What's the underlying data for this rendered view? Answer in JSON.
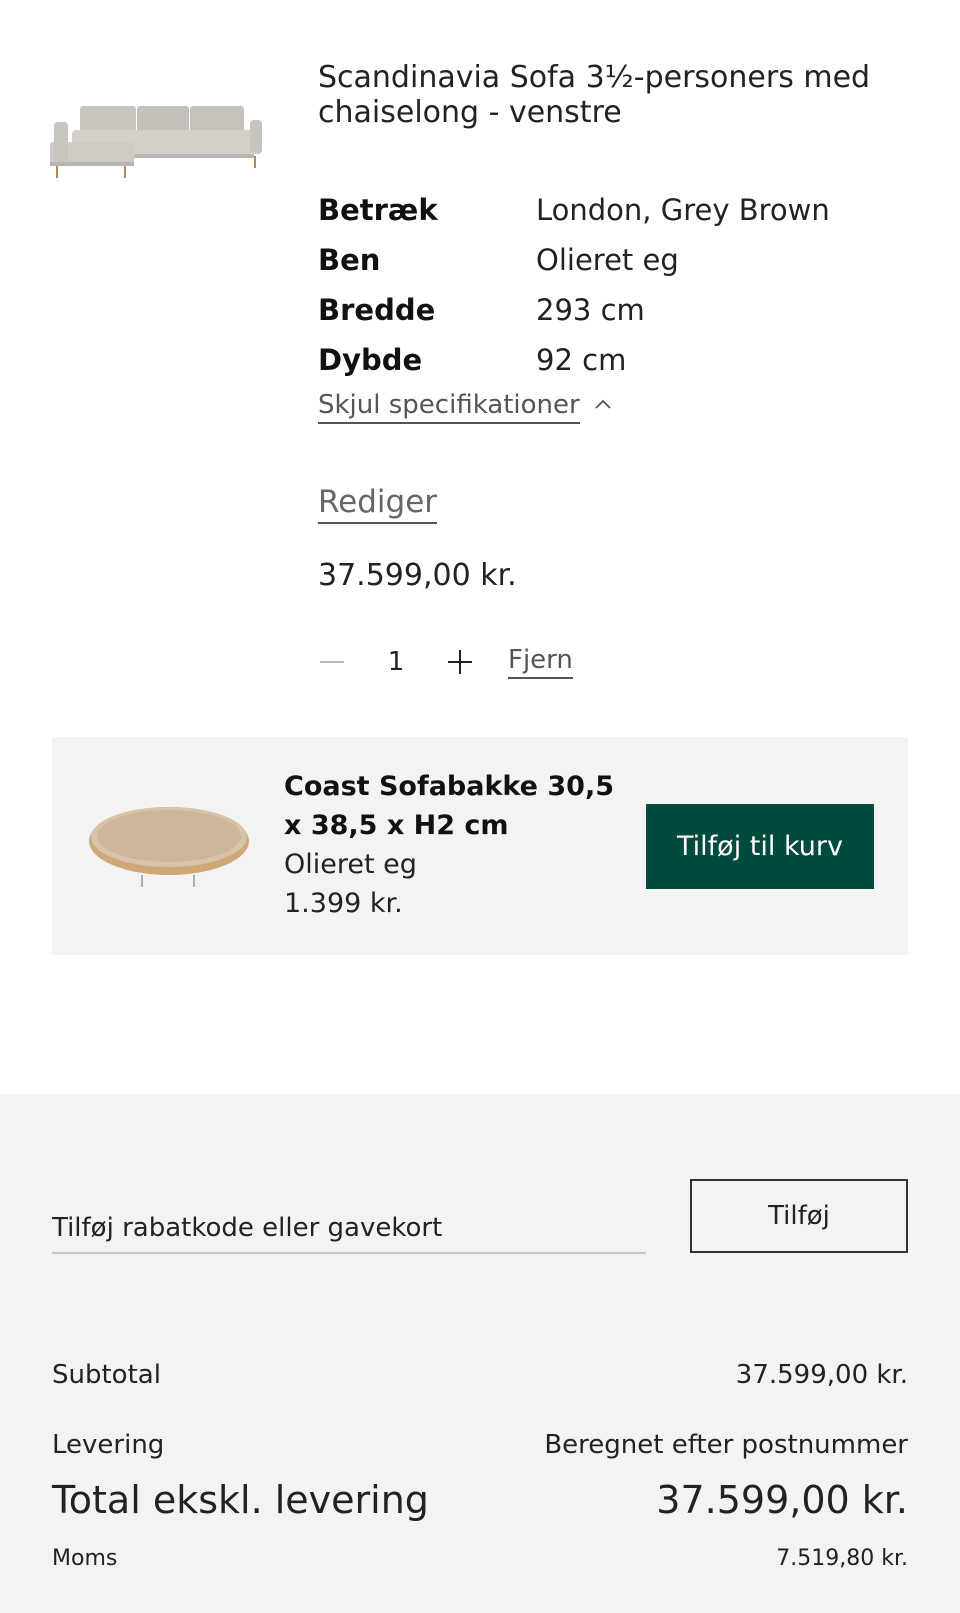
{
  "product": {
    "title": "Scandinavia Sofa 3½-personers med chaiselong - venstre",
    "specs": [
      {
        "key": "Betræk",
        "value": "London, Grey Brown"
      },
      {
        "key": "Ben",
        "value": "Olieret eg"
      },
      {
        "key": "Bredde",
        "value": "293 cm"
      },
      {
        "key": "Dybde",
        "value": "92 cm"
      }
    ],
    "toggle_specs_label": "Skjul specifikationer",
    "edit_label": "Rediger",
    "price": "37.599,00 kr.",
    "quantity": "1",
    "remove_label": "Fjern",
    "image_icon": "sofa-image"
  },
  "upsell": {
    "name": "Coast Sofabakke 30,5 x 38,5 x H2 cm",
    "material": "Olieret eg",
    "price": "1.399 kr.",
    "button_label": "Tilføj til kurv",
    "button_color": "#004b3e",
    "image_icon": "tray-image"
  },
  "summary": {
    "discount_placeholder": "Tilføj rabatkode eller gavekort",
    "discount_button_label": "Tilføj",
    "subtotal_label": "Subtotal",
    "subtotal_value": "37.599,00 kr.",
    "delivery_label": "Levering",
    "delivery_value": "Beregnet efter postnummer",
    "total_label": "Total ekskl. levering",
    "total_value": "37.599,00 kr.",
    "vat_label": "Moms",
    "vat_value": "7.519,80 kr."
  },
  "colors": {
    "accent": "#004b3e",
    "panel_background": "#f3f3f3"
  }
}
